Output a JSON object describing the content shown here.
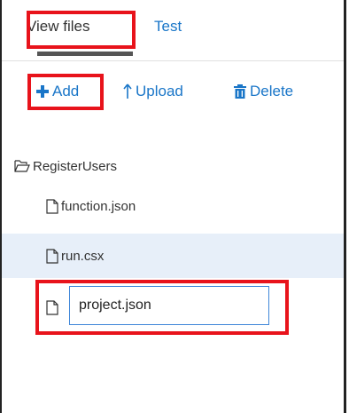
{
  "tabs": [
    {
      "label": "View files",
      "active": true
    },
    {
      "label": "Test",
      "active": false
    }
  ],
  "toolbar": {
    "add_label": "Add",
    "upload_label": "Upload",
    "delete_label": "Delete"
  },
  "tree": {
    "folder": "RegisterUsers",
    "files": [
      {
        "name": "function.json",
        "selected": false
      },
      {
        "name": "run.csx",
        "selected": true
      }
    ],
    "new_file_value": "project.json"
  },
  "colors": {
    "accent": "#1a76c8",
    "highlight": "#e8131b",
    "selected_row": "#e7eff9"
  },
  "icons": {
    "add": "plus-icon",
    "upload": "upload-arrow-icon",
    "delete": "trash-icon",
    "folder": "folder-open-icon",
    "file": "file-icon"
  }
}
